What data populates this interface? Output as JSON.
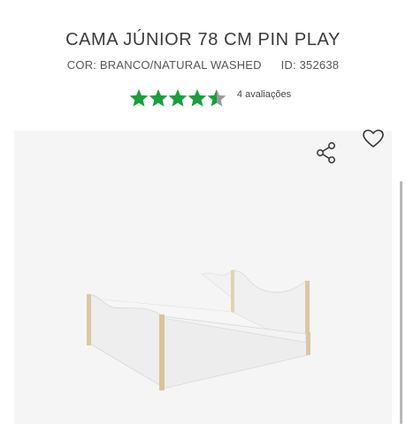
{
  "product": {
    "title": "CAMA JÚNIOR 78 CM PIN PLAY",
    "color_line": "COR: BRANCO/NATURAL WASHED",
    "id_line": "ID: 352638"
  },
  "rating": {
    "value": 4.5,
    "max": 5,
    "reviews_label": "4 avaliações",
    "star_color": "#1a9e3f",
    "star_empty_color": "#9a9a9a"
  },
  "gallery": {
    "favorite_icon": "heart-icon",
    "share_icon": "share-icon",
    "background": "#f5f5f5"
  }
}
